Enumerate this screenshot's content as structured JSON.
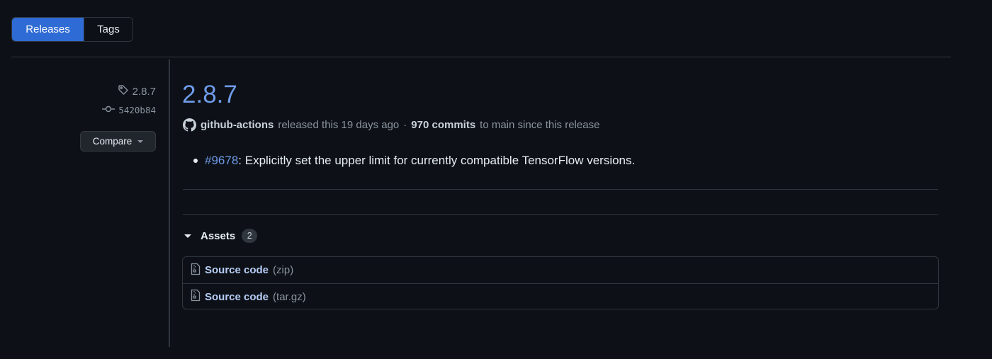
{
  "tabs": [
    {
      "label": "Releases",
      "active": true
    },
    {
      "label": "Tags",
      "active": false
    }
  ],
  "sidebar": {
    "tag": "2.8.7",
    "commit": "5420b84",
    "compare_label": "Compare"
  },
  "release": {
    "title": "2.8.7",
    "author": "github-actions",
    "released_text": "released this 19 days ago",
    "separator": "·",
    "commits_count": "970 commits",
    "commits_suffix": "to main since this release",
    "note_pr": "#9678",
    "note_text": ": Explicitly set the upper limit for currently compatible TensorFlow versions."
  },
  "assets": {
    "label": "Assets",
    "count": "2",
    "items": [
      {
        "name": "Source code",
        "ext": "(zip)"
      },
      {
        "name": "Source code",
        "ext": "(tar.gz)"
      }
    ]
  },
  "colors": {
    "background": "#0d1117",
    "accent_blue": "#2f6bd4",
    "link_blue": "#6f9be8",
    "muted": "#8b949e",
    "border": "#30363d"
  }
}
